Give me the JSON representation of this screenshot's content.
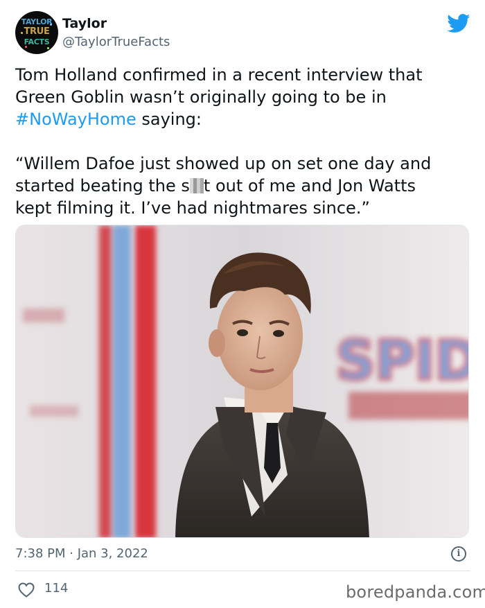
{
  "user": {
    "name": "Taylor",
    "handle": "@TaylorTrueFacts",
    "avatar_text": [
      "TAYLOR",
      "TRUE",
      "FACTS"
    ]
  },
  "tweet": {
    "line1": "Tom Holland confirmed in a recent interview that",
    "line2": "Green Goblin wasn’t originally going to be in",
    "hashtag": "#NoWayHome",
    "line3_rest": " saying:",
    "quote1": "“Willem Dafoe just showed up on set one day and",
    "quote2_a": "started beating the s",
    "quote2_b": "t out of me and Jon Watts",
    "quote3": "kept filming it. I’ve had nightmares since.”"
  },
  "photo": {
    "backdrop_text": "SPID"
  },
  "footer": {
    "timestamp": "7:38 PM · Jan 3, 2022",
    "info_glyph": "i",
    "likes": "114",
    "watermark": "boredpanda.com"
  },
  "colors": {
    "link": "#1d9bf0",
    "twitter_blue": "#1d9bf0",
    "muted": "#536471"
  },
  "icons": [
    "twitter-bird-icon",
    "info-icon",
    "heart-icon"
  ]
}
